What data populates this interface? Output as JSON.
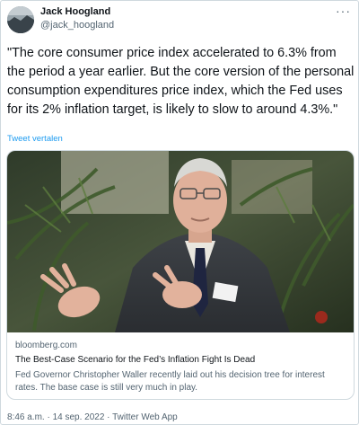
{
  "author": {
    "name": "Jack Hoogland",
    "handle": "@jack_hoogland"
  },
  "more_icon": "more-dots-icon",
  "tweet": {
    "text": "\"The core consumer price index accelerated to 6.3% from the period a year earlier. But the core version of the personal consumption expenditures price index, which the Fed uses for its 2% inflation target, is likely to slow to around 4.3%.\"",
    "translate_label": "Tweet vertalen"
  },
  "card": {
    "domain": "bloomberg.com",
    "title": "The Best-Case Scenario for the Fed’s Inflation Fight Is Dead",
    "description": "Fed Governor Christopher Waller recently laid out his decision tree for interest rates. The base case is still very much in play."
  },
  "meta": "8:46 a.m. · 14 sep. 2022 · Twitter Web App",
  "colors": {
    "link": "#1d9bf0",
    "secondary_text": "#536471",
    "border": "#cfd9de"
  }
}
